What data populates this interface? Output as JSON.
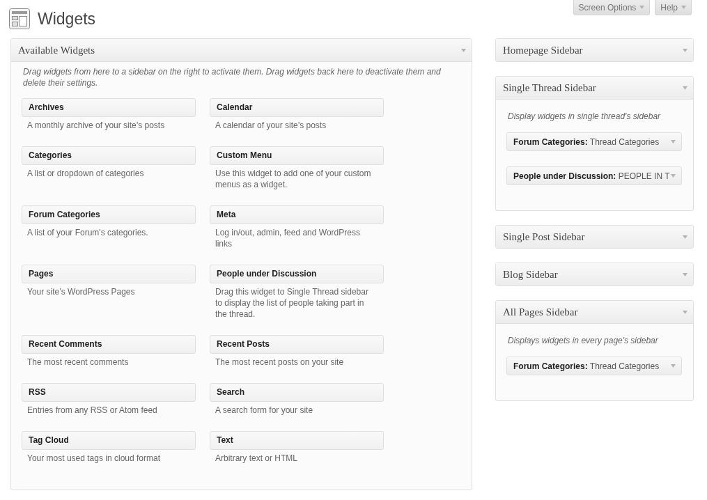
{
  "page": {
    "title": "Widgets"
  },
  "screen_meta_buttons": [
    {
      "label": "Screen Options"
    },
    {
      "label": "Help"
    }
  ],
  "available_widgets": {
    "title": "Available Widgets",
    "description": "Drag widgets from here to a sidebar on the right to activate them. Drag widgets back here to deactivate them and delete their settings.",
    "widgets": [
      {
        "name": "Archives",
        "description": "A monthly archive of your site’s posts"
      },
      {
        "name": "Calendar",
        "description": "A calendar of your site’s posts"
      },
      {
        "name": "Categories",
        "description": "A list or dropdown of categories"
      },
      {
        "name": "Custom Menu",
        "description": "Use this widget to add one of your custom menus as a widget."
      },
      {
        "name": "Forum Categories",
        "description": "A list of your Forum's categories."
      },
      {
        "name": "Meta",
        "description": "Log in/out, admin, feed and WordPress links"
      },
      {
        "name": "Pages",
        "description": "Your site’s WordPress Pages"
      },
      {
        "name": "People under Discussion",
        "description": "Drag this widget to Single Thread sidebar to display the list of people taking part in the thread."
      },
      {
        "name": "Recent Comments",
        "description": "The most recent comments"
      },
      {
        "name": "Recent Posts",
        "description": "The most recent posts on your site"
      },
      {
        "name": "RSS",
        "description": "Entries from any RSS or Atom feed"
      },
      {
        "name": "Search",
        "description": "A search form for your site"
      },
      {
        "name": "Tag Cloud",
        "description": "Your most used tags in cloud format"
      },
      {
        "name": "Text",
        "description": "Arbitrary text or HTML"
      }
    ]
  },
  "sidebars": [
    {
      "title": "Homepage Sidebar",
      "expanded": false
    },
    {
      "title": "Single Thread Sidebar",
      "expanded": true,
      "description": "Display widgets in single thread's sidebar",
      "widgets": [
        {
          "label": "**Forum Categories:** Thread Categories"
        },
        {
          "label": "**People under Discussion:** PEOPLE IN T"
        }
      ]
    },
    {
      "title": "Single Post Sidebar",
      "expanded": false
    },
    {
      "title": "Blog Sidebar",
      "expanded": false
    },
    {
      "title": "All Pages Sidebar",
      "expanded": true,
      "description": "Displays widgets in every page's sidebar",
      "widgets": [
        {
          "label": "**Forum Categories:** Thread Categories"
        }
      ]
    }
  ]
}
